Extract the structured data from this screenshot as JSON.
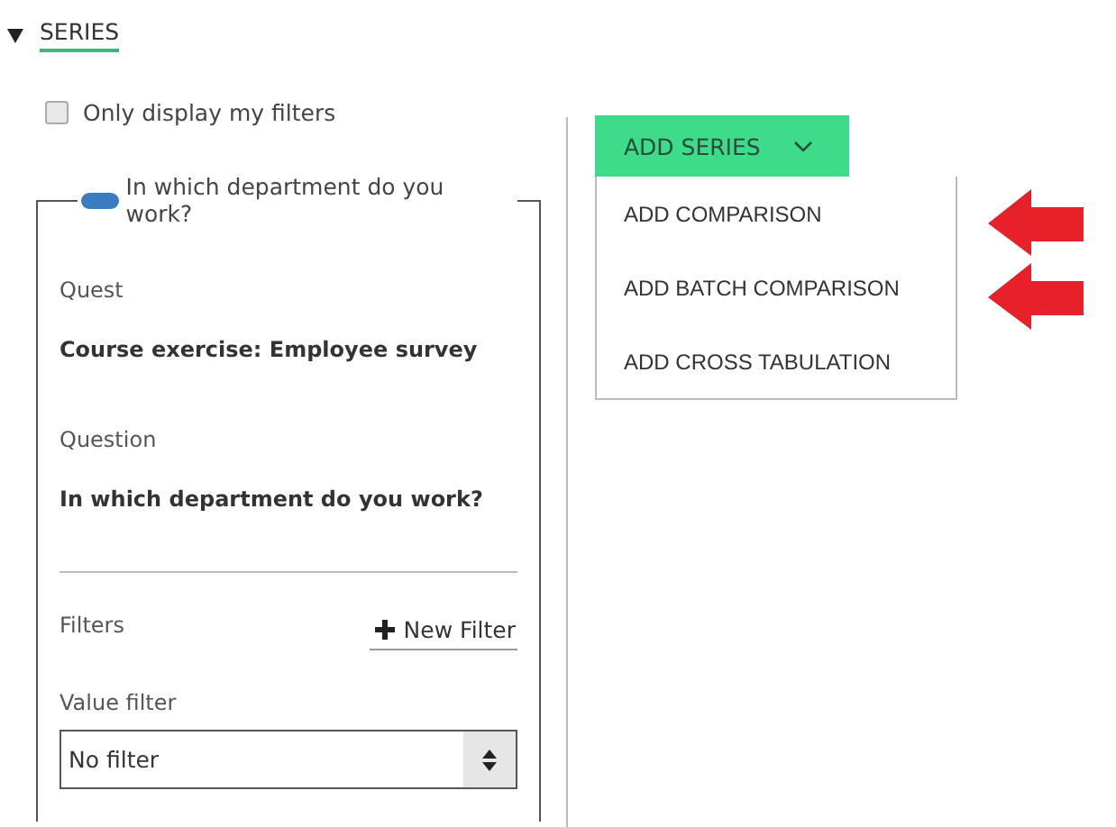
{
  "section": {
    "title": "SERIES",
    "expanded": true
  },
  "only_my_filters": {
    "label": "Only display my filters",
    "checked": false
  },
  "series_panel": {
    "toggle_on": true,
    "legend": "In which department do you work?",
    "fields": [
      {
        "label": "Quest",
        "value": "Course exercise: Employee survey"
      },
      {
        "label": "Question",
        "value": "In which department do you work?"
      }
    ],
    "filters_label": "Filters",
    "new_filter": "New Filter",
    "value_filter_label": "Value filter",
    "value_filter": "No filter"
  },
  "add_series": {
    "label": "ADD SERIES",
    "expanded": true,
    "items": [
      {
        "label": "ADD COMPARISON",
        "marked": true
      },
      {
        "label": "ADD BATCH COMPARISON",
        "marked": true
      },
      {
        "label": "ADD CROSS TABULATION",
        "marked": false
      }
    ]
  }
}
